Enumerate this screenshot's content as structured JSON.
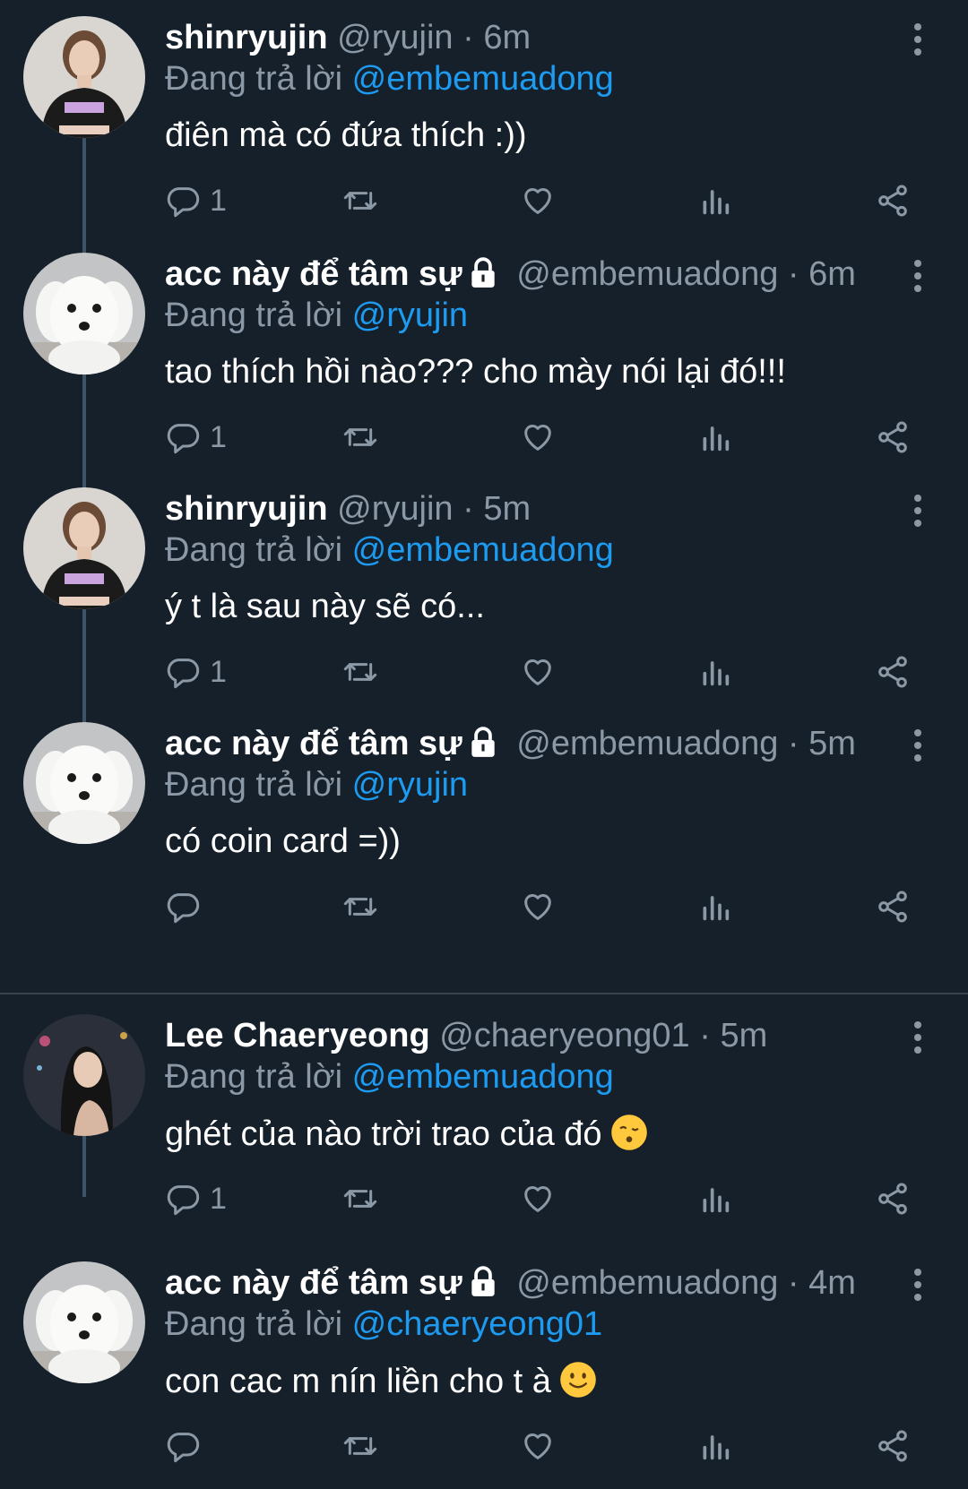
{
  "tweets": [
    {
      "name": "shinryujin",
      "handle": "@ryujin",
      "dot": "·",
      "time": "6m",
      "reply_prefix": "Đang trả lời",
      "reply_to": "@embemuadong",
      "text": "điên mà có đứa thích :))",
      "reply_count": "1",
      "avatar": "girl-avatar"
    },
    {
      "name": "acc này để tâm sự",
      "handle": "@embemuadong",
      "dot": "·",
      "time": "6m",
      "reply_prefix": "Đang trả lời",
      "reply_to": "@ryujin",
      "text": "tao thích hồi nào??? cho mày nói lại đó!!!",
      "reply_count": "1",
      "avatar": "dog-avatar"
    },
    {
      "name": "shinryujin",
      "handle": "@ryujin",
      "dot": "·",
      "time": "5m",
      "reply_prefix": "Đang trả lời",
      "reply_to": "@embemuadong",
      "text": "ý t là sau này sẽ có...",
      "reply_count": "1",
      "avatar": "girl-avatar"
    },
    {
      "name": "acc này để tâm sự",
      "handle": "@embemuadong",
      "dot": "·",
      "time": "5m",
      "reply_prefix": "Đang trả lời",
      "reply_to": "@ryujin",
      "text": "có coin card =))",
      "reply_count": "",
      "avatar": "dog-avatar"
    },
    {
      "name": "Lee Chaeryeong",
      "handle": "@chaeryeong01",
      "dot": "·",
      "time": "5m",
      "reply_prefix": "Đang trả lời",
      "reply_to": "@embemuadong",
      "text": "ghét của nào trời trao của đó",
      "reply_count": "1",
      "avatar": "woman-avatar",
      "emoji": "kissing-face-emoji"
    },
    {
      "name": "acc này để tâm sự",
      "handle": "@embemuadong",
      "dot": "·",
      "time": "4m",
      "reply_prefix": "Đang trả lời",
      "reply_to": "@chaeryeong01",
      "text": "con cac m nín liền cho t à",
      "reply_count": "",
      "avatar": "dog-avatar",
      "emoji": "slightly-smiling-face-emoji"
    }
  ],
  "colors": {
    "background": "#15202b",
    "muted": "#8b98a5",
    "accent": "#1d9bf0",
    "thread_line": "#3d5466"
  }
}
